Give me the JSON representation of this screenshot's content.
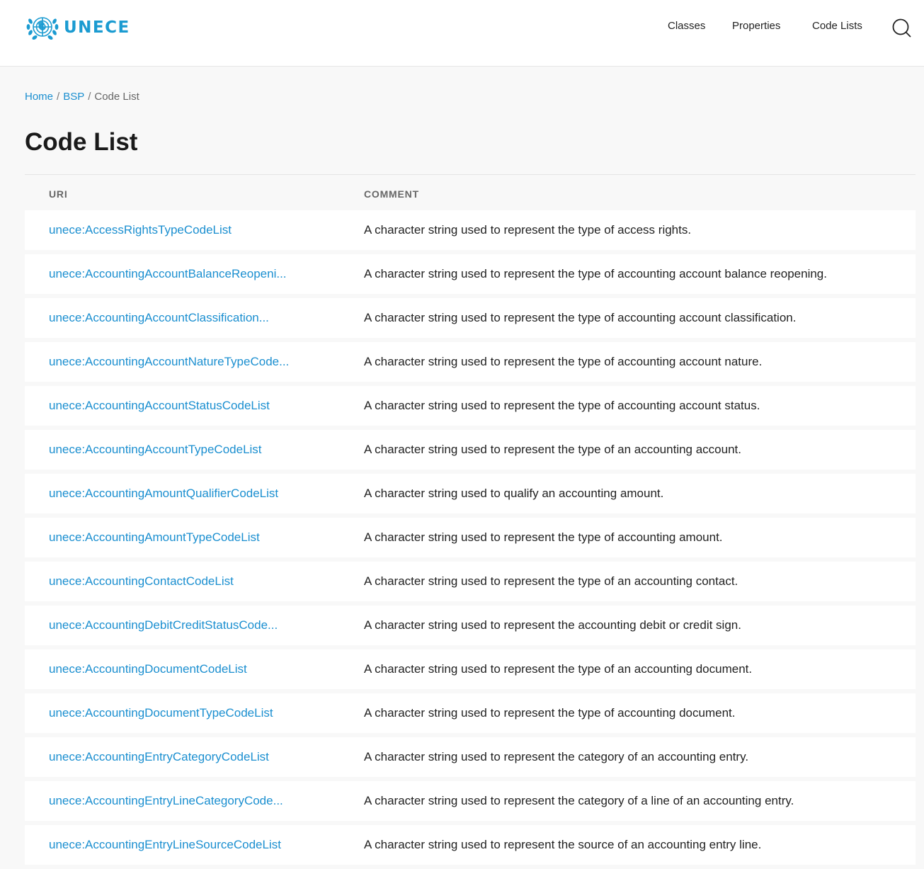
{
  "header": {
    "logo_text": "UNECE",
    "logo_icon": "un-emblem-icon",
    "nav": [
      {
        "label": "Classes"
      },
      {
        "label": "Properties"
      },
      {
        "label": "Code Lists"
      }
    ],
    "search_icon": "search-icon"
  },
  "breadcrumb": {
    "home": "Home",
    "section": "BSP",
    "current": "Code List",
    "separator": "/"
  },
  "page_title": "Code List",
  "table": {
    "columns": {
      "uri": "URI",
      "comment": "COMMENT"
    },
    "rows": [
      {
        "uri": "unece:AccessRightsTypeCodeList",
        "comment": "A character string used to represent the type of access rights."
      },
      {
        "uri": "unece:AccountingAccountBalanceReopeni...",
        "comment": "A character string used to represent the type of accounting account balance reopening."
      },
      {
        "uri": "unece:AccountingAccountClassification...",
        "comment": "A character string used to represent the type of accounting account classification."
      },
      {
        "uri": "unece:AccountingAccountNatureTypeCode...",
        "comment": "A character string used to represent the type of accounting account nature."
      },
      {
        "uri": "unece:AccountingAccountStatusCodeList",
        "comment": "A character string used to represent the type of accounting account status."
      },
      {
        "uri": "unece:AccountingAccountTypeCodeList",
        "comment": "A character string used to represent the type of an accounting account."
      },
      {
        "uri": "unece:AccountingAmountQualifierCodeList",
        "comment": "A character string used to qualify an accounting amount."
      },
      {
        "uri": "unece:AccountingAmountTypeCodeList",
        "comment": "A character string used to represent the type of accounting amount."
      },
      {
        "uri": "unece:AccountingContactCodeList",
        "comment": "A character string used to represent the type of an accounting contact."
      },
      {
        "uri": "unece:AccountingDebitCreditStatusCode...",
        "comment": "A character string used to represent the accounting debit or credit sign."
      },
      {
        "uri": "unece:AccountingDocumentCodeList",
        "comment": "A character string used to represent the type of an accounting document."
      },
      {
        "uri": "unece:AccountingDocumentTypeCodeList",
        "comment": "A character string used to represent the type of accounting document."
      },
      {
        "uri": "unece:AccountingEntryCategoryCodeList",
        "comment": "A character string used to represent the category of an accounting entry."
      },
      {
        "uri": "unece:AccountingEntryLineCategoryCode...",
        "comment": "A character string used to represent the category of a line of an accounting entry."
      },
      {
        "uri": "unece:AccountingEntryLineSourceCodeList",
        "comment": "A character string used to represent the source of an accounting entry line."
      }
    ]
  },
  "colors": {
    "accent": "#1b8fd0",
    "logo": "#1b9bd1",
    "background": "#f8f8f8",
    "row_background": "#ffffff"
  }
}
